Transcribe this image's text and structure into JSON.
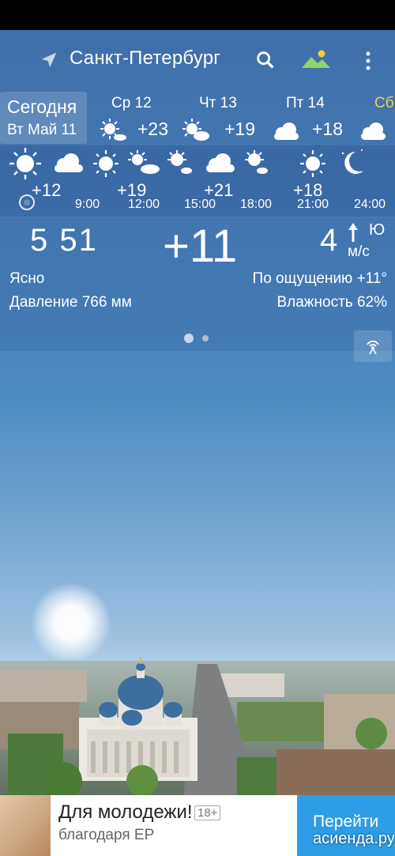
{
  "header": {
    "city": "Санкт-Петербург"
  },
  "days": {
    "today_label": "Сегодня",
    "today_date": "Вт Май 11",
    "forecast": [
      {
        "name": "Ср 12",
        "temp": "+23",
        "icon": "sun-cloud-icon"
      },
      {
        "name": "Чт 13",
        "temp": "+19",
        "icon": "sun-cloud-icon"
      },
      {
        "name": "Пт 14",
        "temp": "+18",
        "icon": "cloud-icon"
      },
      {
        "name": "Сб",
        "temp": "",
        "icon": "cloud-icon"
      }
    ]
  },
  "hourly": {
    "temps": [
      "+12",
      "+19",
      "+21",
      "+18"
    ],
    "times": [
      "9:00",
      "12:00",
      "15:00",
      "18:00",
      "21:00",
      "24:00"
    ],
    "icons": [
      "sun-icon",
      "cloud-icon",
      "sun-icon",
      "sun-cloud-icon",
      "sun-cloud-icon",
      "cloud-icon",
      "sun-cloud-icon",
      "sun-icon",
      "moon-icon"
    ]
  },
  "current": {
    "time": "5 51",
    "temp": "+11",
    "wind_speed": "4",
    "wind_dir": "Ю",
    "wind_unit": "м/с",
    "condition": "Ясно",
    "feels_like": "По ощущению +11°",
    "pressure": "Давление 766 мм",
    "humidity": "Влажность 62%"
  },
  "ad": {
    "title": "Для молодежи!",
    "age": "18+",
    "subtitle": "благодаря ЕР",
    "button": "Перейти"
  },
  "watermark": "асиенда.ру",
  "colors": {
    "accent_day": "#f3cd4c",
    "ad_button": "#2e9ce6"
  }
}
